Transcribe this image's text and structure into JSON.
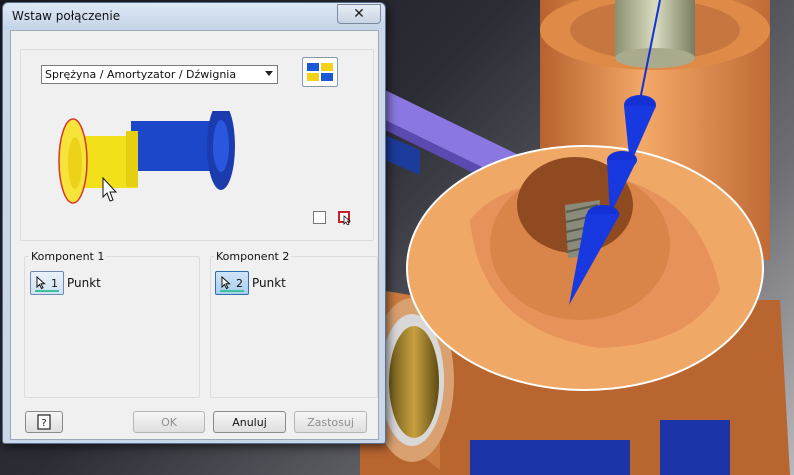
{
  "dialog": {
    "title": "Wstaw połączenie",
    "close_icon": "close-x-icon",
    "joint_type": {
      "selected": "Sprężyna / Amortyzator / Dźwignia"
    },
    "component1": {
      "label": "Komponent 1",
      "select_number": "1",
      "select_value": "Punkt"
    },
    "component2": {
      "label": "Komponent 2",
      "select_number": "2",
      "select_value": "Punkt"
    },
    "buttons": {
      "ok": "OK",
      "cancel": "Anuluj",
      "apply": "Zastosuj"
    }
  },
  "colors": {
    "dialog_bg": "#f0f0f0",
    "part_orange": "#e8924f",
    "preview_yellow": "#f2e01a",
    "preview_blue": "#1d47c9",
    "arrow_blue": "#1431d6"
  }
}
